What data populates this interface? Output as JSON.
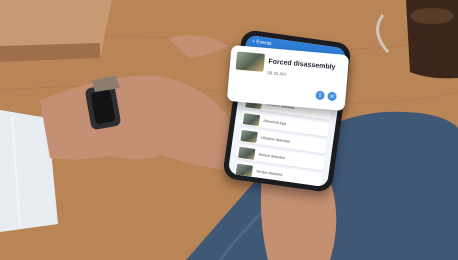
{
  "phone": {
    "header_label": "Events",
    "event_rows": [
      {
        "label": "Vibration detected"
      },
      {
        "label": "Abnormal logs"
      },
      {
        "label": "Vibration detected"
      },
      {
        "label": "Sensor detected"
      },
      {
        "label": "Sensor detected"
      }
    ]
  },
  "popup": {
    "title": "Forced disassembly",
    "subtitle": "09:35 AM"
  },
  "icons": {
    "back": "chevron-left-icon",
    "share": "share-icon",
    "delete": "trash-icon"
  }
}
